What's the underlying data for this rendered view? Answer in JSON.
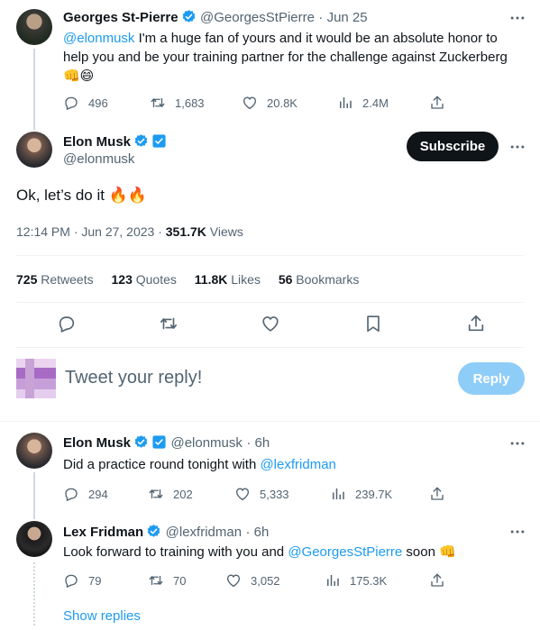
{
  "tweet_gsp": {
    "name": "Georges St-Pierre",
    "handle": "@GeorgesStPierre",
    "date": "· Jun 25",
    "mention": "@elonmusk",
    "text_after": " I'm a huge fan of yours and it would be an absolute honor to help you and be your training partner for the challenge against Zuckerberg",
    "emojis": "👊😄",
    "replies": "496",
    "retweets": "1,683",
    "likes": "20.8K",
    "views": "2.4M"
  },
  "main_tweet": {
    "name": "Elon Musk",
    "handle": "@elonmusk",
    "subscribe_label": "Subscribe",
    "text": "Ok, let’s do it",
    "emojis": "🔥🔥",
    "timestamp": "12:14 PM · Jun 27, 2023 · ",
    "views_count": "351.7K",
    "views_label": " Views",
    "stats": {
      "retweets_count": "725",
      "retweets_label": " Retweets",
      "quotes_count": "123",
      "quotes_label": " Quotes",
      "likes_count": "11.8K",
      "likes_label": " Likes",
      "bookmarks_count": "56",
      "bookmarks_label": " Bookmarks"
    }
  },
  "composer": {
    "placeholder": "Tweet your reply!",
    "reply_label": "Reply"
  },
  "reply_elon": {
    "name": "Elon Musk",
    "handle": "@elonmusk",
    "date": "· 6h",
    "text_before": "Did a practice round tonight with ",
    "mention": "@lexfridman",
    "replies": "294",
    "retweets": "202",
    "likes": "5,333",
    "views": "239.7K"
  },
  "reply_lex": {
    "name": "Lex Fridman",
    "handle": "@lexfridman",
    "date": "· 6h",
    "text_before": "Look forward to training with you and ",
    "mention": "@GeorgesStPierre",
    "text_after": " soon ",
    "emoji": "👊",
    "replies": "79",
    "retweets": "70",
    "likes": "3,052",
    "views": "175.3K"
  },
  "show_replies": "Show replies",
  "colors": {
    "accent": "#1d9bf0",
    "reply_button": "#8ecdf8",
    "text_secondary": "#536471"
  }
}
